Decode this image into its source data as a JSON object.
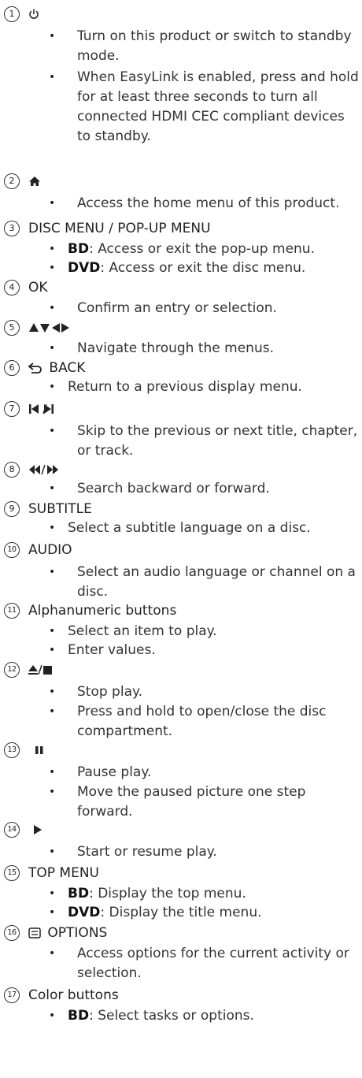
{
  "items": [
    {
      "n": "1",
      "title": "",
      "icon": "power-icon",
      "bullets": [
        "Turn on this product or switch to standby mode.",
        "When EasyLink is enabled, press and hold for at least three seconds to turn all connected HDMI CEC compliant devices to standby."
      ]
    },
    {
      "n": "2",
      "title": "",
      "icon": "home-icon",
      "bullets": [
        "Access the home menu of this product."
      ]
    },
    {
      "n": "3",
      "title": "DISC MENU / POP-UP MENU",
      "icon": "",
      "bullets": [
        {
          "bold": "BD",
          "rest": ": Access or exit the pop-up menu."
        },
        {
          "bold": "DVD",
          "rest": ": Access or exit the disc menu."
        }
      ]
    },
    {
      "n": "4",
      "title": "OK",
      "icon": "",
      "bullets": [
        "Confirm an entry or selection."
      ]
    },
    {
      "n": "5",
      "title": "",
      "icon": "navigation-arrows-icon",
      "bullets": [
        "Navigate through the menus."
      ]
    },
    {
      "n": "6",
      "title": "BACK",
      "icon": "back-arrow-icon",
      "bullets": [
        "Return to a previous display menu."
      ]
    },
    {
      "n": "7",
      "title": "",
      "icon": "skip-previous-next-icon",
      "bullets": [
        "Skip to the previous or next title, chapter, or track."
      ]
    },
    {
      "n": "8",
      "title": "",
      "icon": "rewind-forward-icon",
      "bullets": [
        "Search backward or forward."
      ]
    },
    {
      "n": "9",
      "title": "SUBTITLE",
      "icon": "",
      "bullets": [
        "Select a subtitle language on a disc."
      ]
    },
    {
      "n": "10",
      "title": "AUDIO",
      "icon": "",
      "bullets": [
        "Select an audio language or channel on a disc."
      ]
    },
    {
      "n": "11",
      "title": "Alphanumeric buttons",
      "icon": "",
      "bullets": [
        "Select an item to play.",
        "Enter values."
      ]
    },
    {
      "n": "12",
      "title": "",
      "icon": "eject-stop-icon",
      "bullets": [
        "Stop play.",
        "Press and hold to open/close the disc compartment."
      ]
    },
    {
      "n": "13",
      "title": "",
      "icon": "pause-icon",
      "bullets": [
        "Pause play.",
        "Move the paused picture one step forward."
      ]
    },
    {
      "n": "14",
      "title": "",
      "icon": "play-icon",
      "bullets": [
        "Start or resume play."
      ]
    },
    {
      "n": "15",
      "title": "TOP MENU",
      "icon": "",
      "bullets": [
        {
          "bold": "BD",
          "rest": ": Display the top menu."
        },
        {
          "bold": "DVD",
          "rest": ": Display the title menu."
        }
      ]
    },
    {
      "n": "16",
      "title": "OPTIONS",
      "icon": "options-icon",
      "bullets": [
        "Access options for the current activity or selection."
      ]
    },
    {
      "n": "17",
      "title": "Color buttons",
      "icon": "",
      "bullets": [
        {
          "bold": "BD",
          "rest": ": Select tasks or options."
        }
      ]
    }
  ],
  "bullet_symbol": "•"
}
